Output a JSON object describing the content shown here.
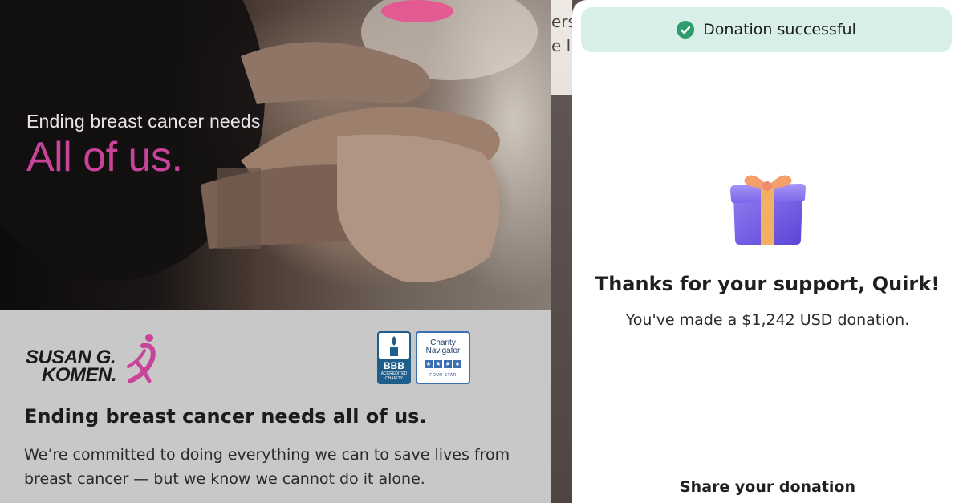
{
  "hero": {
    "line1": "Ending breast cancer needs",
    "line2": "All of us."
  },
  "background_strip": {
    "text": "ers\ne l"
  },
  "organization": {
    "name_line1": "SUSAN G.",
    "name_line2": "KOMEN.",
    "badges": {
      "bbb": {
        "label": "BBB",
        "sub": "ACCREDITED CHARITY"
      },
      "charity_navigator": {
        "label": "Charity Navigator",
        "rating": "FOUR-STAR"
      }
    },
    "heading": "Ending breast cancer needs all of us.",
    "body": "We’re committed to doing everything we can to save lives from breast cancer — but we know we cannot do it alone."
  },
  "modal": {
    "toast": "Donation successful",
    "title": "Thanks for your support, Quirk!",
    "subtitle": "You've made a $1,242 USD donation.",
    "share_label": "Share your donation"
  },
  "colors": {
    "brand_pink": "#c8439a",
    "toast_bg": "#d7efe8",
    "success_green": "#2e9d6b"
  },
  "icons": [
    "check-circle-icon",
    "gift-icon",
    "pink-ribbon-icon"
  ]
}
